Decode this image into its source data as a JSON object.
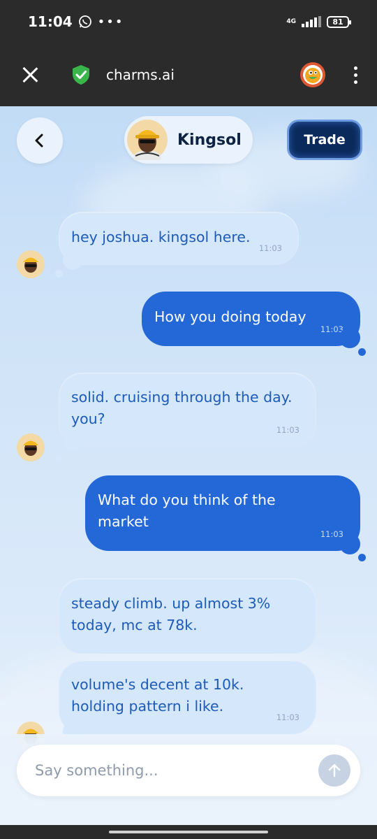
{
  "status_bar": {
    "time": "11:04",
    "network": "4G",
    "battery": "81"
  },
  "browser": {
    "url": "charms.ai"
  },
  "chat_header": {
    "name": "Kingsol",
    "trade_label": "Trade"
  },
  "messages": [
    {
      "sender": "bot",
      "text": "hey joshua. kingsol here.",
      "time": "11:03"
    },
    {
      "sender": "user",
      "text": "How you doing today",
      "time": "11:03"
    },
    {
      "sender": "bot",
      "text": "solid. cruising through the day. you?",
      "time": "11:03"
    },
    {
      "sender": "user",
      "text": "What do you think of the market",
      "time": "11:03"
    },
    {
      "sender": "bot",
      "text": "steady climb. up almost 3% today, mc at 78k.",
      "time": ""
    },
    {
      "sender": "bot",
      "text": "volume's decent at 10k. holding pattern i like.",
      "time": "11:03"
    }
  ],
  "composer": {
    "placeholder": "Say something..."
  },
  "colors": {
    "accent": "#2468d8",
    "bot_bubble": "#d5e7fb",
    "trade_button": "#0b2a5c"
  }
}
